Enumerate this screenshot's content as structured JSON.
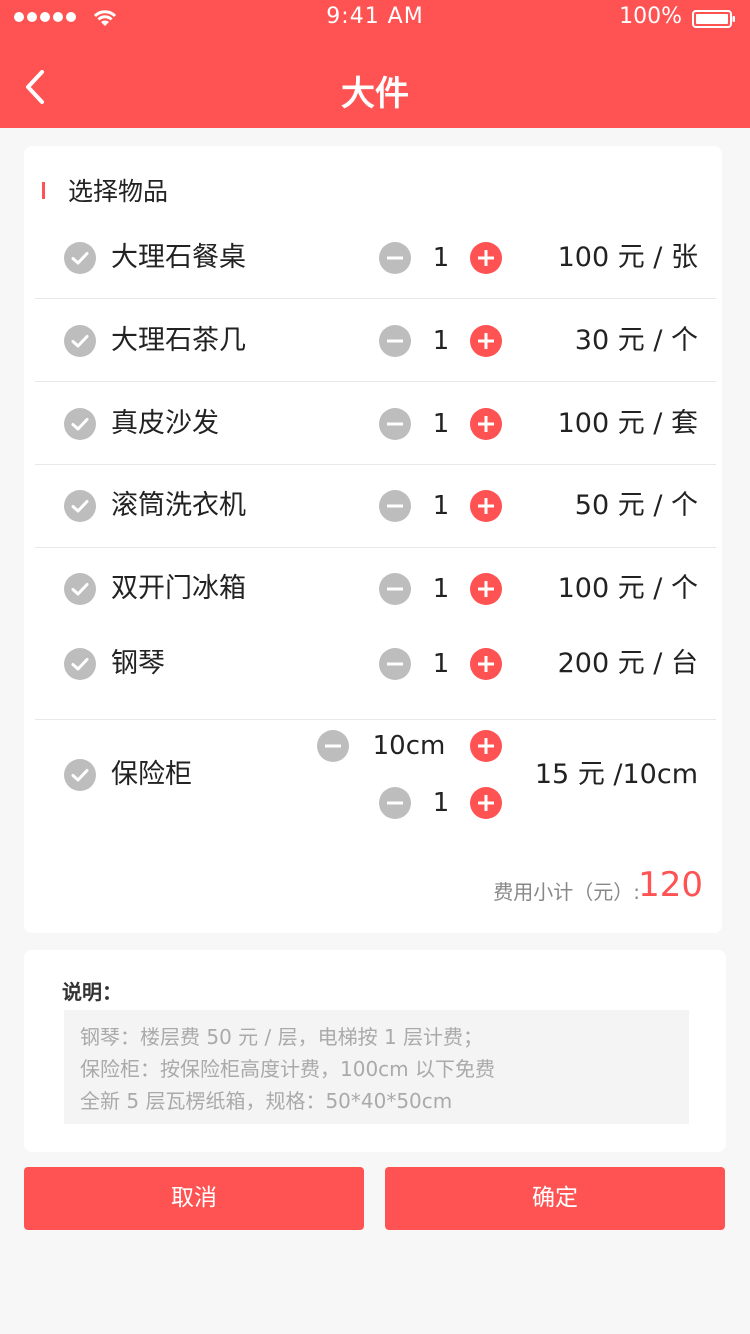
{
  "status_bar": {
    "time": "9:41 AM",
    "battery_percent": "100%",
    "signal_icon": "signal-dots-icon",
    "wifi_icon": "wifi-icon",
    "battery_icon": "battery-icon"
  },
  "header": {
    "title": "大件",
    "back_icon": "chevron-left-icon",
    "background": "#ff5252"
  },
  "section": {
    "title": "选择物品"
  },
  "items": [
    {
      "name": "大理石餐桌",
      "qty": "1",
      "price": "100 元 / 张"
    },
    {
      "name": "大理石茶几",
      "qty": "1",
      "price": "30 元 / 个"
    },
    {
      "name": "真皮沙发",
      "qty": "1",
      "price": "100 元 / 套"
    },
    {
      "name": "滚筒洗衣机",
      "qty": "1",
      "price": "50 元 / 个"
    },
    {
      "name": "双开门冰箱",
      "qty": "1",
      "price": "100 元 / 个"
    },
    {
      "name": "钢琴",
      "qty": "1",
      "price": "200 元 / 台"
    }
  ],
  "safe": {
    "name": "保险柜",
    "height": "10cm",
    "qty": "1",
    "price": "15 元 /10cm"
  },
  "subtotal": {
    "label": "费用小计（元）:",
    "value": "120"
  },
  "notes": {
    "title": "说明：",
    "lines": [
      "钢琴：楼层费 50 元 / 层，电梯按 1 层计费；",
      "保险柜：按保险柜高度计费，100cm 以下免费",
      "全新 5 层瓦楞纸箱，规格：50*40*50cm"
    ]
  },
  "buttons": {
    "cancel": "取消",
    "confirm": "确定"
  },
  "colors": {
    "accent": "#ff5252",
    "check_gray": "#bdbdbd",
    "minus_gray": "#bdbdbd"
  }
}
